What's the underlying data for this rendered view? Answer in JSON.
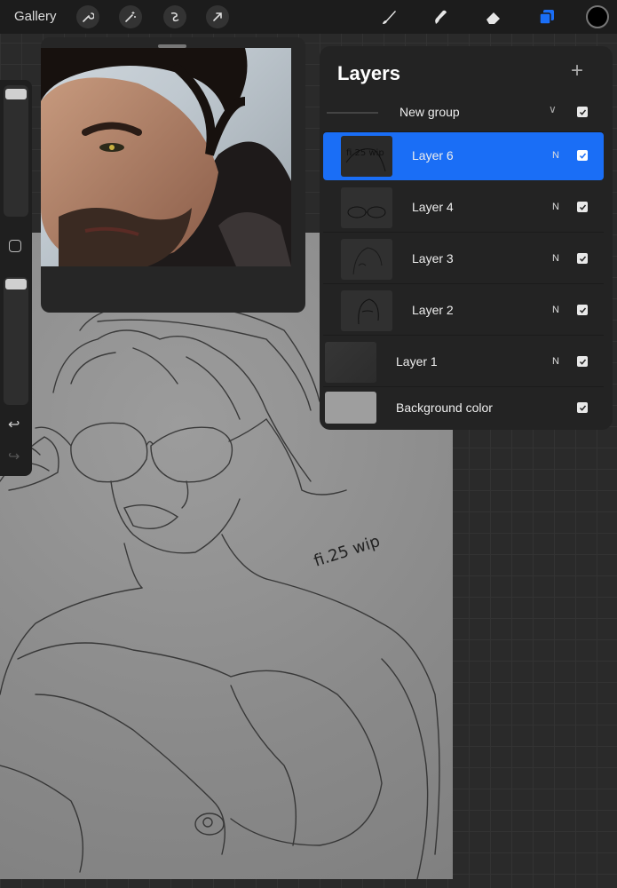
{
  "toolbar": {
    "gallery_label": "Gallery",
    "left_tools": [
      "wrench-icon",
      "magic-wand-icon",
      "selection-icon",
      "transform-arrow-icon"
    ],
    "right_tools": [
      "brush-icon",
      "smudge-icon",
      "eraser-icon",
      "layers-icon"
    ],
    "active_tool": "layers-icon",
    "accent": "#1a6ef6",
    "current_color": "#000000"
  },
  "layers_panel": {
    "title": "Layers",
    "add_label": "+",
    "group": {
      "name": "New group",
      "visible": true,
      "expanded": true
    },
    "layers": [
      {
        "name": "Layer 6",
        "mode": "N",
        "visible": true,
        "selected": true,
        "thumb_text": "fi.25 wip"
      },
      {
        "name": "Layer 4",
        "mode": "N",
        "visible": true,
        "selected": false
      },
      {
        "name": "Layer 3",
        "mode": "N",
        "visible": true,
        "selected": false
      },
      {
        "name": "Layer 2",
        "mode": "N",
        "visible": true,
        "selected": false
      },
      {
        "name": "Layer 1",
        "mode": "N",
        "visible": true,
        "selected": false
      }
    ],
    "background": {
      "name": "Background color",
      "visible": true,
      "color": "#9e9e9e"
    }
  },
  "canvas": {
    "signature": "fi.25 wip"
  }
}
